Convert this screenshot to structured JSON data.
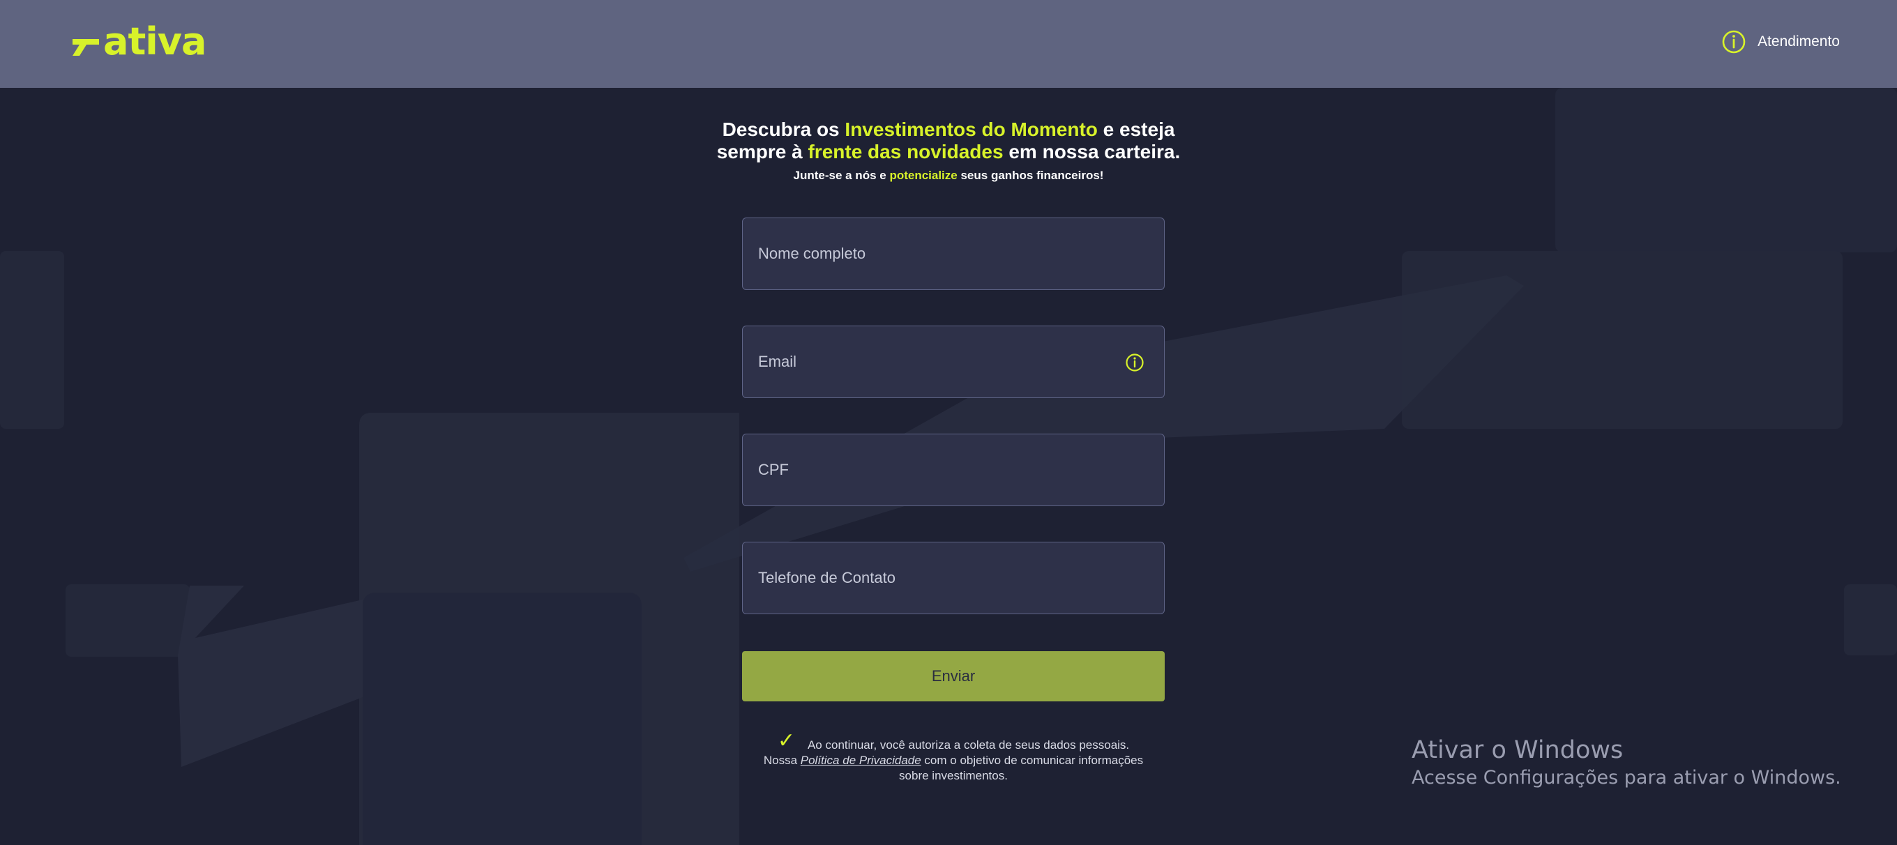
{
  "header": {
    "logo_text": "ativa",
    "support_label": "Atendimento"
  },
  "hero": {
    "line1_a": "Descubra os ",
    "line1_b": "Investimentos do Momento",
    "line1_c": " e esteja",
    "line2_a": "sempre à ",
    "line2_b": "frente das novidades",
    "line2_c": " em nossa carteira.",
    "sub_a": "Junte-se a nós e ",
    "sub_b": "potencialize",
    "sub_c": " seus ganhos financeiros!"
  },
  "form": {
    "name_placeholder": "Nome completo",
    "email_placeholder": "Email",
    "cpf_placeholder": "CPF",
    "phone_placeholder": "Telefone de Contato",
    "submit_label": "Enviar"
  },
  "consent": {
    "line1": "Ao continuar, você autoriza a coleta de seus dados pessoais.",
    "line2_a": "Nossa ",
    "policy_link": "Política de Privacidade",
    "line2_b": " com o objetivo de comunicar informações",
    "line3": "sobre investimentos."
  },
  "watermark": {
    "title": "Ativar o Windows",
    "subtitle": "Acesse Configurações para ativar o Windows."
  },
  "colors": {
    "accent": "#d8f22a",
    "background": "#1e2133",
    "header": "#5f6480",
    "field": "#2e3149",
    "button": "#94a844"
  },
  "icons": [
    "info-icon",
    "logo-mark-icon",
    "checkmark-icon"
  ]
}
